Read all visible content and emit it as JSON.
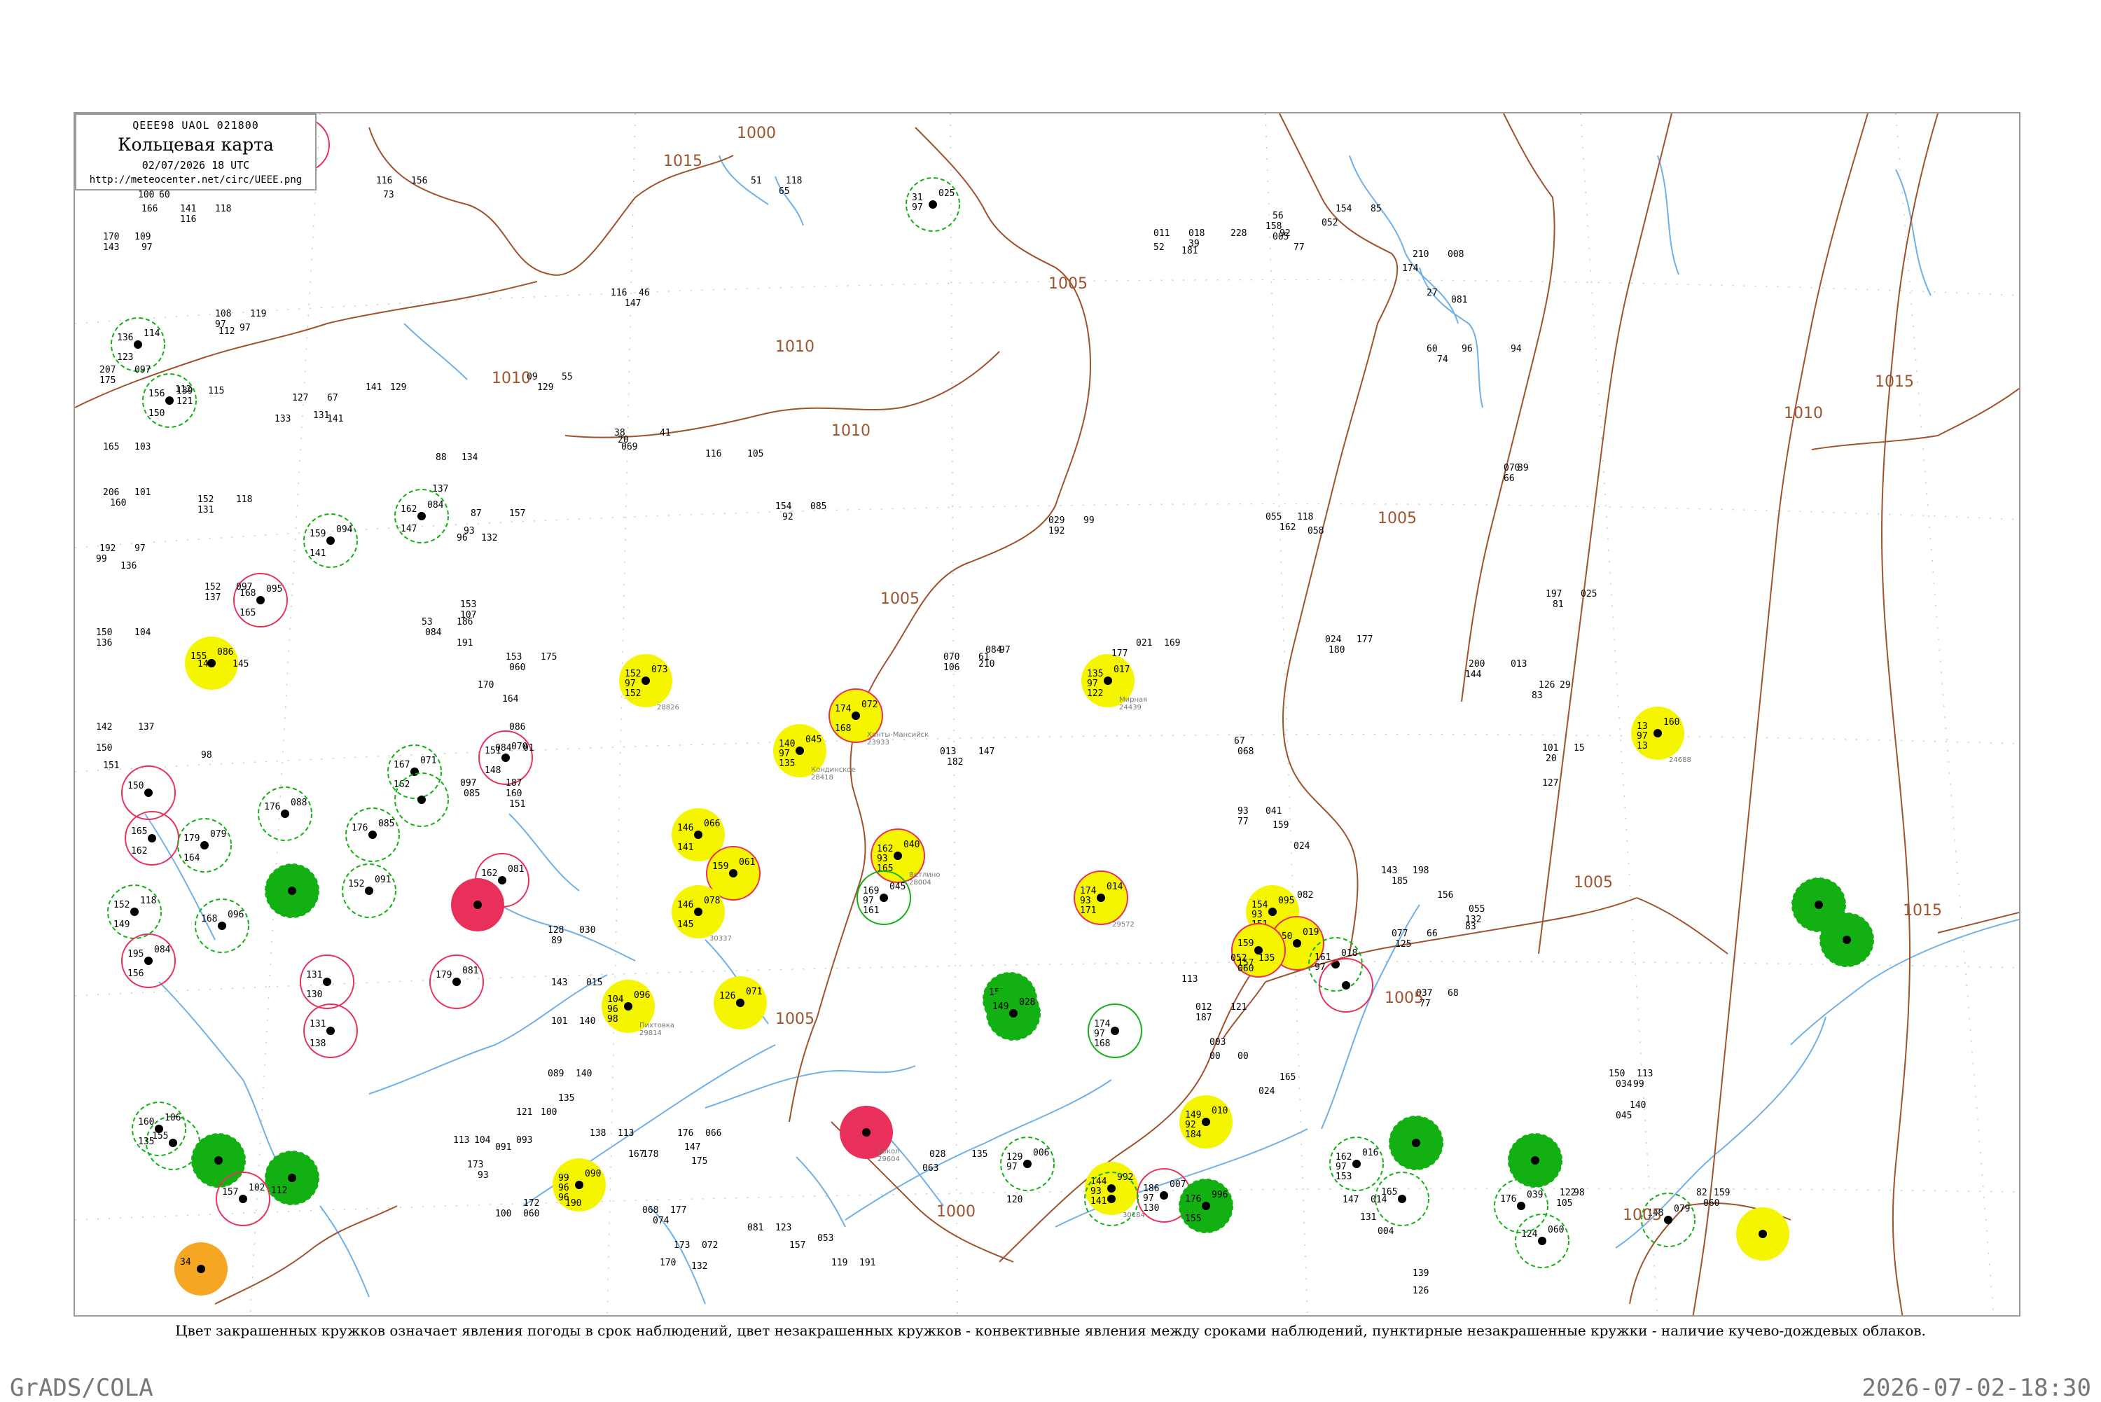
{
  "header": {
    "code_line": "QEEE98  UAOL  021800",
    "title": "Кольцевая карта",
    "datetime": "02/07/2026 18 UTC",
    "url": "http://meteocenter.net/circ/UEEE.png"
  },
  "caption": "Цвет закрашенных кружков означает явления погоды в срок наблюдений, цвет незакрашенных кружков - конвективные явления между сроками наблюдений, пунктирные незакрашенные кружки - наличие кучево-дождевых облаков.",
  "footer": {
    "left": "GrADS/COLA",
    "right": "2026-07-02-18:30"
  },
  "colors": {
    "isobar": "#a0522d",
    "river": "#6fb0e8",
    "grid": "#c8c8c8",
    "thunder_fill": "#12b012",
    "thunder_ring": "#12b012",
    "rain_fill": "#f5f500",
    "light_fill": "#f8f4a0",
    "heavy_fill": "#e8305a",
    "heavy_ring": "#e8305a",
    "dust_fill": "#f5a623"
  },
  "isobar_labels": [
    "1000",
    "1005",
    "1005",
    "1005",
    "1005",
    "1005",
    "1005",
    "1005",
    "1010",
    "1010",
    "1010",
    "1010",
    "1015",
    "1015",
    "1015",
    "1000"
  ],
  "stations": [
    {
      "mark": "yellow",
      "n1": "140",
      "n2": "97",
      "n3": "135",
      "p": "045",
      "name": "Кондинское",
      "code": "28418"
    },
    {
      "mark": "yellow-ring",
      "n1": "174",
      "n2": "",
      "n3": "168",
      "p": "072",
      "name": "Ханты-Мансийск",
      "code": "23933"
    },
    {
      "mark": "yellow-ring",
      "n1": "162",
      "n2": "93",
      "n3": "165",
      "p": "040",
      "name": "Ветлино",
      "code": "28004"
    },
    {
      "mark": "green-ring",
      "n1": "169",
      "n2": "97",
      "n3": "161",
      "p": "045",
      "name": "",
      "code": ""
    },
    {
      "mark": "yellow",
      "n1": "135",
      "n2": "97",
      "n3": "122",
      "p": "017",
      "name": "Мирная",
      "code": "24439"
    },
    {
      "mark": "yellow-ring",
      "n1": "174",
      "n2": "93",
      "n3": "171",
      "p": "014",
      "name": "",
      "code": "29572"
    },
    {
      "mark": "yellow",
      "n1": "154",
      "n2": "93",
      "n3": "151",
      "p": "095",
      "name": "",
      "code": ""
    },
    {
      "mark": "yellow-ring",
      "n1": "150",
      "n2": "",
      "n3": "",
      "p": "019",
      "name": "",
      "code": ""
    },
    {
      "mark": "yellow-ring",
      "n1": "159",
      "n2": "",
      "n3": "157",
      "p": "",
      "name": "",
      "code": ""
    },
    {
      "mark": "green-dash",
      "n1": "161",
      "n2": "97",
      "n3": "",
      "p": "018",
      "name": "",
      "code": ""
    },
    {
      "mark": "green",
      "n1": "151",
      "n2": "",
      "n3": "148",
      "p": "",
      "name": "",
      "code": ""
    },
    {
      "mark": "green-ring",
      "n1": "174",
      "n2": "97",
      "n3": "168",
      "p": "",
      "name": "",
      "code": ""
    },
    {
      "mark": "yellow",
      "n1": "149",
      "n2": "92",
      "n3": "184",
      "p": "010",
      "name": "",
      "code": ""
    },
    {
      "mark": "green-dash",
      "n1": "129",
      "n2": "97",
      "n3": "",
      "p": "006",
      "name": "",
      "code": ""
    },
    {
      "mark": "yellow",
      "n1": "144",
      "n2": "93",
      "n3": "141",
      "p": "992",
      "name": "",
      "code": "30184"
    },
    {
      "mark": "red-ring",
      "n1": "186",
      "n2": "97",
      "n3": "130",
      "p": "007",
      "name": "",
      "code": ""
    },
    {
      "mark": "green",
      "n1": "176",
      "n2": "",
      "n3": "155",
      "p": "996",
      "name": "",
      "code": ""
    },
    {
      "mark": "green-dash",
      "n1": "162",
      "n2": "97",
      "n3": "153",
      "p": "016",
      "name": "",
      "code": ""
    },
    {
      "mark": "red",
      "n1": "",
      "n2": "",
      "n3": "",
      "p": "",
      "name": "",
      "code": ""
    },
    {
      "mark": "yellow",
      "n1": "104",
      "n2": "96",
      "n3": "98",
      "p": "096",
      "name": "Пихтовка",
      "code": "29814"
    },
    {
      "mark": "yellow",
      "n1": "99",
      "n2": "96",
      "n3": "96",
      "p": "090",
      "name": "",
      "code": ""
    },
    {
      "mark": "red",
      "n1": "",
      "n2": "",
      "n3": "",
      "p": "",
      "name": "Сокол",
      "code": "29604"
    },
    {
      "mark": "red-ring",
      "n1": "162",
      "n2": "",
      "n3": "",
      "p": "081",
      "name": "",
      "code": ""
    },
    {
      "mark": "red-ring",
      "n1": "151",
      "n2": "",
      "n3": "148",
      "p": "070",
      "name": "",
      "code": ""
    },
    {
      "mark": "yellow",
      "n1": "152",
      "n2": "97",
      "n3": "152",
      "p": "073",
      "name": "",
      "code": "28826"
    },
    {
      "mark": "yellow",
      "n1": "146",
      "n2": "",
      "n3": "141",
      "p": "066",
      "name": "",
      "code": "30795"
    },
    {
      "mark": "yellow-ring",
      "n1": "159",
      "n2": "",
      "n3": "",
      "p": "061",
      "name": "",
      "code": ""
    },
    {
      "mark": "yellow",
      "n1": "146",
      "n2": "",
      "n3": "145",
      "p": "078",
      "name": "",
      "code": "30337"
    },
    {
      "mark": "yellow",
      "n1": "126",
      "n2": "",
      "n3": "",
      "p": "071",
      "name": "",
      "code": ""
    },
    {
      "mark": "green",
      "n1": "149",
      "n2": "",
      "n3": "",
      "p": "028",
      "name": "",
      "code": ""
    },
    {
      "mark": "green-dash",
      "n1": "155",
      "n2": "",
      "n3": "",
      "p": "",
      "name": "",
      "code": ""
    },
    {
      "mark": "red-ring",
      "n1": "179",
      "n2": "",
      "n3": "",
      "p": "081",
      "name": "",
      "code": ""
    },
    {
      "mark": "red-ring",
      "n1": "131",
      "n2": "",
      "n3": "130",
      "p": "",
      "name": "",
      "code": ""
    },
    {
      "mark": "red-ring",
      "n1": "131",
      "n2": "",
      "n3": "138",
      "p": "",
      "name": "",
      "code": ""
    },
    {
      "mark": "green",
      "n1": "",
      "n2": "",
      "n3": "",
      "p": "",
      "name": "",
      "code": ""
    },
    {
      "mark": "green",
      "n1": "",
      "n2": "",
      "n3": "112",
      "p": "",
      "name": "",
      "code": ""
    },
    {
      "mark": "green-dash",
      "n1": "160",
      "n2": "",
      "n3": "135",
      "p": "106",
      "name": "",
      "code": ""
    },
    {
      "mark": "red-ring",
      "n1": "157",
      "n2": "",
      "n3": "",
      "p": "102",
      "name": "",
      "code": ""
    },
    {
      "mark": "orange",
      "n1": "34",
      "n2": "",
      "n3": "",
      "p": "",
      "name": "",
      "code": ""
    },
    {
      "mark": "green-dash",
      "n1": "152",
      "n2": "",
      "n3": "149",
      "p": "118",
      "name": "",
      "code": ""
    },
    {
      "mark": "red-ring",
      "n1": "195",
      "n2": "",
      "n3": "156",
      "p": "084",
      "name": "",
      "code": ""
    },
    {
      "mark": "red-ring",
      "n1": "150",
      "n2": "",
      "n3": "",
      "p": "",
      "name": "",
      "code": ""
    },
    {
      "mark": "red-ring",
      "n1": "165",
      "n2": "",
      "n3": "162",
      "p": "",
      "name": "",
      "code": ""
    },
    {
      "mark": "green",
      "n1": "",
      "n2": "",
      "n3": "",
      "p": "",
      "name": "",
      "code": ""
    },
    {
      "mark": "green-dash",
      "n1": "152",
      "n2": "",
      "n3": "",
      "p": "091",
      "name": "",
      "code": ""
    },
    {
      "mark": "green-dash",
      "n1": "176",
      "n2": "",
      "n3": "",
      "p": "085",
      "name": "",
      "code": ""
    },
    {
      "mark": "green-dash",
      "n1": "179",
      "n2": "",
      "n3": "164",
      "p": "079",
      "name": "",
      "code": ""
    },
    {
      "mark": "green-dash",
      "n1": "168",
      "n2": "",
      "n3": "",
      "p": "096",
      "name": "",
      "code": ""
    },
    {
      "mark": "green-dash",
      "n1": "176",
      "n2": "",
      "n3": "",
      "p": "088",
      "name": "",
      "code": ""
    },
    {
      "mark": "green-dash",
      "n1": "167",
      "n2": "",
      "n3": "162",
      "p": "071",
      "name": "",
      "code": ""
    },
    {
      "mark": "yellow",
      "n1": "155",
      "n2": "",
      "n3": "",
      "p": "086",
      "name": "",
      "code": ""
    },
    {
      "mark": "red-ring",
      "n1": "168",
      "n2": "",
      "n3": "165",
      "p": "095",
      "name": "",
      "code": ""
    },
    {
      "mark": "green-dash",
      "n1": "159",
      "n2": "",
      "n3": "141",
      "p": "094",
      "name": "",
      "code": ""
    },
    {
      "mark": "green-dash",
      "n1": "162",
      "n2": "",
      "n3": "147",
      "p": "084",
      "name": "",
      "code": ""
    },
    {
      "mark": "green-dash",
      "n1": "156",
      "n2": "",
      "n3": "150",
      "p": "112",
      "name": "",
      "code": ""
    },
    {
      "mark": "green-dash",
      "n1": "136",
      "n2": "",
      "n3": "123",
      "p": "114",
      "name": "",
      "code": ""
    },
    {
      "mark": "green-dash",
      "n1": "31",
      "n2": "97",
      "n3": "",
      "p": "025",
      "name": "",
      "code": ""
    },
    {
      "mark": "yellow",
      "n1": "13",
      "n2": "97",
      "n3": "13",
      "p": "160",
      "name": "",
      "code": "24688"
    },
    {
      "mark": "green",
      "n1": "",
      "n2": "",
      "n3": "",
      "p": "",
      "name": "",
      "code": ""
    },
    {
      "mark": "green",
      "n1": "",
      "n2": "",
      "n3": "",
      "p": "",
      "name": "",
      "code": ""
    },
    {
      "mark": "green",
      "n1": "",
      "n2": "",
      "n3": "",
      "p": "",
      "name": "",
      "code": ""
    },
    {
      "mark": "green",
      "n1": "",
      "n2": "",
      "n3": "",
      "p": "",
      "name": "",
      "code": ""
    },
    {
      "mark": "green-dash",
      "n1": "165",
      "n2": "",
      "n3": "",
      "p": "",
      "name": "",
      "code": ""
    },
    {
      "mark": "green-dash",
      "n1": "124",
      "n2": "",
      "n3": "",
      "p": "060",
      "name": "",
      "code": ""
    },
    {
      "mark": "green-dash",
      "n1": "176",
      "n2": "",
      "n3": "",
      "p": "039",
      "name": "",
      "code": ""
    },
    {
      "mark": "green-dash",
      "n1": "148",
      "n2": "",
      "n3": "",
      "p": "079",
      "name": "",
      "code": ""
    },
    {
      "mark": "yellow",
      "n1": "",
      "n2": "",
      "n3": "",
      "p": "",
      "name": "",
      "code": ""
    },
    {
      "mark": "red-ring",
      "n1": "",
      "n2": "",
      "n3": "",
      "p": "",
      "name": "",
      "code": ""
    },
    {
      "mark": "green-dash",
      "n1": "",
      "n2": "",
      "n3": "",
      "p": "",
      "name": "",
      "code": ""
    },
    {
      "mark": "red-ring",
      "n1": "",
      "n2": "",
      "n3": "",
      "p": "",
      "name": "",
      "code": ""
    },
    {
      "mark": "green-dash",
      "n1": "",
      "n2": "",
      "n3": "",
      "p": "",
      "name": "",
      "code": ""
    }
  ],
  "plain_numbers": [
    "116",
    "156",
    "73",
    "141",
    "118",
    "116",
    "170",
    "109",
    "143",
    "97",
    "207",
    "097",
    "175",
    "139",
    "115",
    "121",
    "165",
    "103",
    "206",
    "101",
    "160",
    "152",
    "118",
    "131",
    "192",
    "97",
    "99",
    "136",
    "152",
    "097",
    "137",
    "150",
    "104",
    "136",
    "144",
    "145",
    "142",
    "137",
    "150",
    "98",
    "151",
    "108",
    "119",
    "97",
    "112",
    "97",
    "141",
    "129",
    "127",
    "67",
    "131",
    "133",
    "141",
    "88",
    "134",
    "137",
    "87",
    "157",
    "93",
    "96",
    "132",
    "100",
    "60",
    "166",
    "51",
    "118",
    "65",
    "116",
    "46",
    "147",
    "09",
    "55",
    "129",
    "38",
    "41",
    "069",
    "20",
    "116",
    "105",
    "53",
    "186",
    "084",
    "107",
    "153",
    "191",
    "153",
    "175",
    "060",
    "170",
    "164",
    "086",
    "084",
    "01",
    "097",
    "187",
    "085",
    "160",
    "151",
    "154",
    "085",
    "92",
    "070",
    "61",
    "106",
    "084",
    "97",
    "210",
    "013",
    "147",
    "182",
    "021",
    "169",
    "177",
    "024",
    "177",
    "180",
    "029",
    "99",
    "192",
    "055",
    "118",
    "162",
    "058",
    "200",
    "013",
    "144",
    "197",
    "025",
    "81",
    "070",
    "39",
    "66",
    "126",
    "29",
    "83",
    "101",
    "15",
    "20",
    "127",
    "67",
    "068",
    "93",
    "041",
    "77",
    "159",
    "024",
    "143",
    "198",
    "185",
    "082",
    "156",
    "055",
    "132",
    "077",
    "66",
    "125",
    "83",
    "037",
    "68",
    "77",
    "052",
    "135",
    "060",
    "128",
    "030",
    "89",
    "143",
    "015",
    "101",
    "140",
    "089",
    "140",
    "121",
    "093",
    "100",
    "135",
    "091",
    "113",
    "104",
    "173",
    "93",
    "172",
    "190",
    "060",
    "100",
    "138",
    "113",
    "167",
    "178",
    "176",
    "066",
    "147",
    "175",
    "068",
    "177",
    "074",
    "173",
    "072",
    "170",
    "132",
    "081",
    "123",
    "157",
    "053",
    "119",
    "191",
    "028",
    "135",
    "063",
    "120",
    "147",
    "014",
    "131",
    "004",
    "139",
    "126",
    "012",
    "121",
    "187",
    "003",
    "00",
    "00",
    "165",
    "024",
    "150",
    "113",
    "034",
    "99",
    "140",
    "045",
    "122",
    "98",
    "105",
    "82",
    "159",
    "060",
    "113",
    "94",
    "154",
    "85",
    "052",
    "92",
    "77",
    "018",
    "39",
    "228",
    "56",
    "158",
    "005",
    "181",
    "011",
    "52",
    "210",
    "008",
    "174",
    "27",
    "081",
    "60",
    "96",
    "74"
  ]
}
